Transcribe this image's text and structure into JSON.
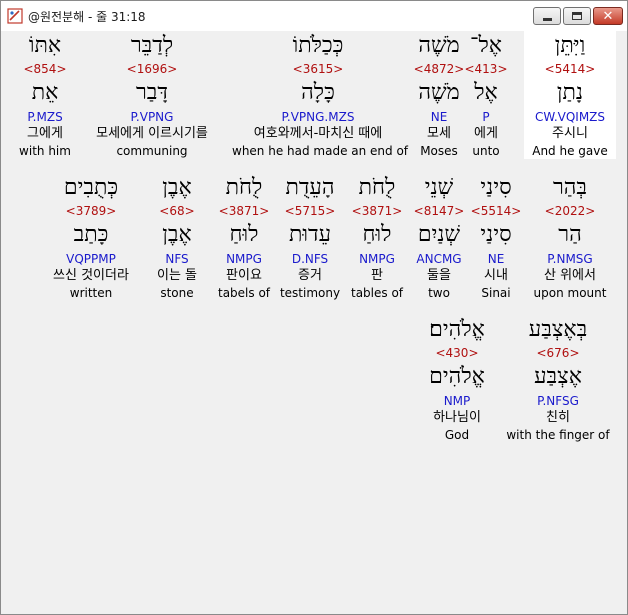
{
  "window": {
    "title": "@원전분해 - 줄 31:18",
    "controls": {
      "minimize": "",
      "maximize": "",
      "close": "✕"
    }
  },
  "rows": [
    {
      "words": [
        {
          "heb": "וַיִּתֵּן",
          "strong": "<5414>",
          "root": "נָתַן",
          "morph": "CW.VQIMZS",
          "kor": "주시니",
          "eng": "And he gave",
          "selected": true
        },
        {
          "heb": "אֶל־",
          "strong": "<413>",
          "root": "אֶל",
          "morph": "P",
          "kor": "에게",
          "eng": "unto"
        },
        {
          "heb": "מֹשֶׁה",
          "strong": "<4872>",
          "root": "מֹשֶׁה",
          "morph": "NE",
          "kor": "모세",
          "eng": "Moses"
        },
        {
          "heb": "כְּכַלֹּתוֹ",
          "strong": "<3615>",
          "root": "כָּלָה",
          "morph": "P.VPNG.MZS",
          "kor": "여호와께서-마치신 때에",
          "eng": "when he had made an end of"
        },
        {
          "heb": "לְדַבֵּר",
          "strong": "<1696>",
          "root": "דָּבַר",
          "morph": "P.VPNG",
          "kor": "모세에게 이르시기를",
          "eng": "communing"
        },
        {
          "heb": "אִתּוֹ",
          "strong": "<854>",
          "root": "אֵת",
          "morph": "P.MZS",
          "kor": "그에게",
          "eng": "with him"
        }
      ]
    },
    {
      "words": [
        {
          "heb": "בְּהַר",
          "strong": "<2022>",
          "root": "הַר",
          "morph": "P.NMSG",
          "kor": "산 위에서",
          "eng": "upon mount"
        },
        {
          "heb": "סִינַי",
          "strong": "<5514>",
          "root": "סִינַי",
          "morph": "NE",
          "kor": "시내",
          "eng": "Sinai"
        },
        {
          "heb": "שְׁנֵי",
          "strong": "<8147>",
          "root": "שְׁנַיִם",
          "morph": "ANCMG",
          "kor": "둘을",
          "eng": "two"
        },
        {
          "heb": "לֻחֹת",
          "strong": "<3871>",
          "root": "לוּחַ",
          "morph": "NMPG",
          "kor": "판",
          "eng": "tables of"
        },
        {
          "heb": "הָעֵדֻת",
          "strong": "<5715>",
          "root": "עֵדוּת",
          "morph": "D.NFS",
          "kor": "증거",
          "eng": "testimony"
        },
        {
          "heb": "לֻחֹת",
          "strong": "<3871>",
          "root": "לוּחַ",
          "morph": "NMPG",
          "kor": "판이요",
          "eng": "tabels of"
        },
        {
          "heb": "אֶבֶן",
          "strong": "<68>",
          "root": "אֶבֶן",
          "morph": "NFS",
          "kor": "이는 돌",
          "eng": "stone"
        },
        {
          "heb": "כְּתֻבִים",
          "strong": "<3789>",
          "root": "כָּתַב",
          "morph": "VQPPMP",
          "kor": "쓰신 것이더라",
          "eng": "written"
        }
      ]
    },
    {
      "words": [
        {
          "heb": "בְּאֶצְבַּע",
          "strong": "<676>",
          "root": "אֶצְבַּע",
          "morph": "P.NFSG",
          "kor": "친히",
          "eng": "with the finger of"
        },
        {
          "heb": "אֱלֹהִים׃",
          "strong": "<430>",
          "root": "אֱלֹהִים",
          "morph": "NMP",
          "kor": "하나님이",
          "eng": "God"
        }
      ]
    }
  ]
}
